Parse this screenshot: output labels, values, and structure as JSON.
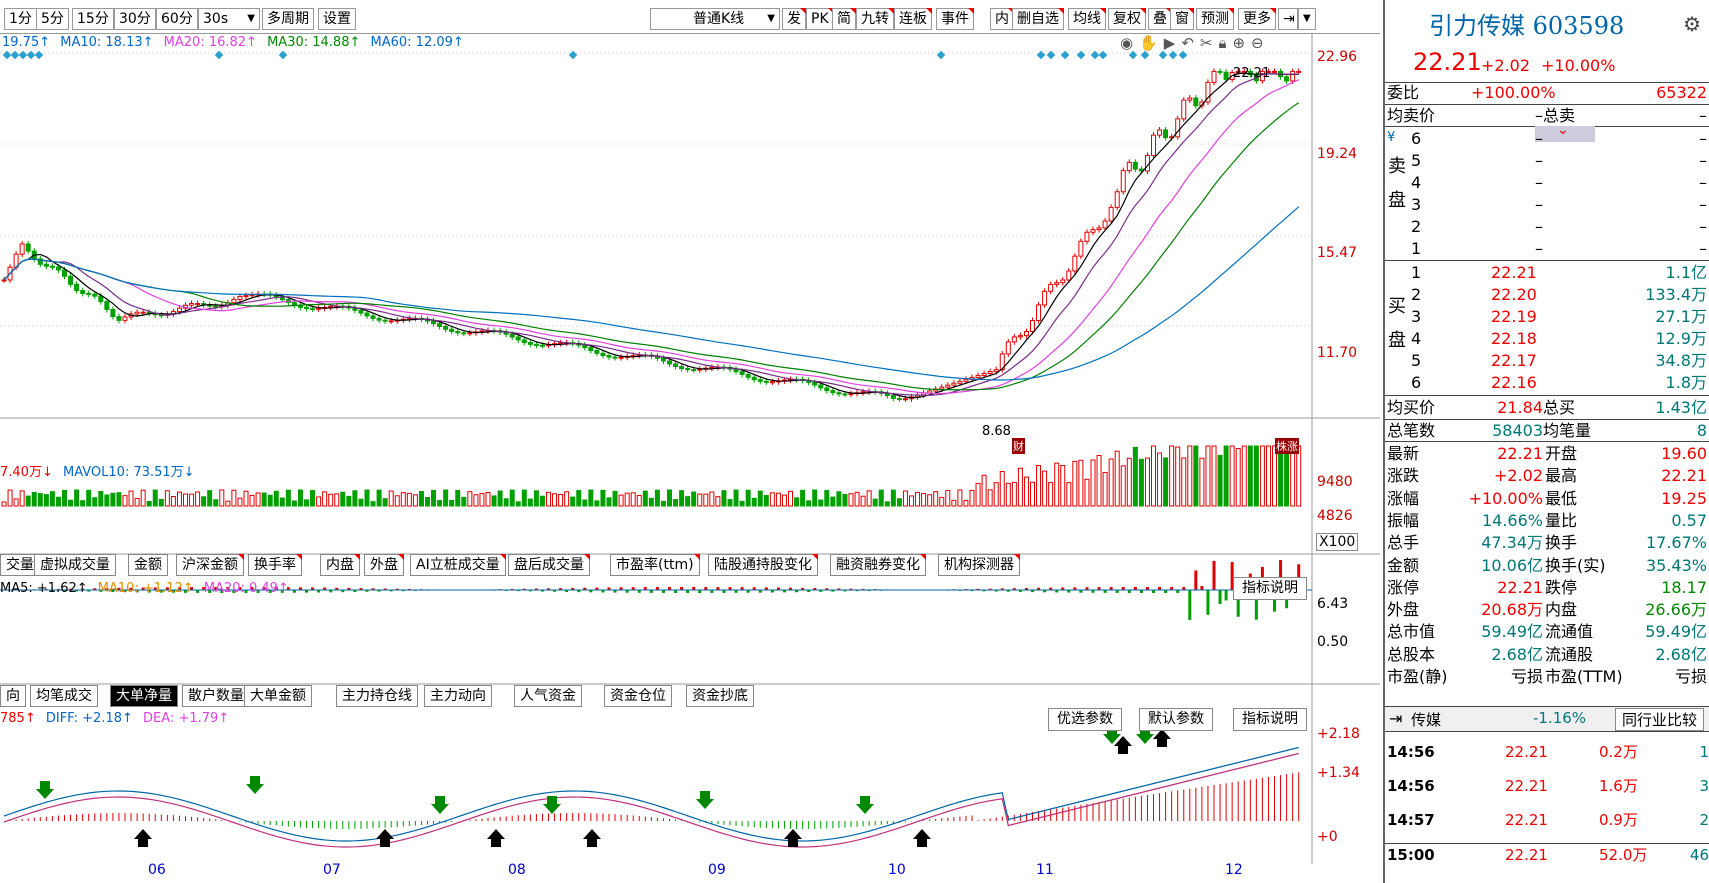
{
  "toolbar": {
    "periods": [
      "1分",
      "5分",
      "15分",
      "30分",
      "60分"
    ],
    "interval": "30s",
    "multi_period": "多周期",
    "settings": "设置",
    "kline_type": "普通K线",
    "tools": [
      "发",
      "PK",
      "简",
      "九转",
      "连板",
      "事件",
      "内",
      "删自选",
      "均线",
      "复权",
      "叠",
      "窗",
      "预测",
      "更多"
    ]
  },
  "ma_legend": {
    "ma5": "19.75↑",
    "ma10": "MA10: 18.13↑",
    "ma20": "MA20: 16.82↑",
    "ma30": "MA30: 14.88↑",
    "ma60": "MA60: 12.09↑"
  },
  "price_axis": [
    "22.96",
    "19.24",
    "15.47",
    "11.70"
  ],
  "price_marks": {
    "high": "22.21",
    "low": "8.68",
    "cai": "财",
    "zhang": "株涨"
  },
  "volume": {
    "legend_a": "7.40万↓",
    "legend_b": "MAVOL10: 73.51万↓",
    "axis": [
      "9480",
      "4826"
    ],
    "unit": "X100"
  },
  "indicator_tabs": [
    "交量",
    "虚拟成交量",
    "金额",
    "沪深金额",
    "换手率",
    "内盘",
    "外盘",
    "AI立桩成交量",
    "盘后成交量",
    "市盈率(ttm)",
    "陆股通持股变化",
    "融资融券变化",
    "机构探测器"
  ],
  "indicator_help": "指标说明",
  "net_panel": {
    "legend_a": "MA5: +1.62↑",
    "legend_b": "MA10: +1.12↑",
    "legend_c": "MA20: 0.49↑",
    "axis": [
      "6.43",
      "0.50"
    ]
  },
  "fund_tabs": [
    "向",
    "均笔成交",
    "大单净量",
    "散户数量",
    "大单金额",
    "主力持仓线",
    "主力动向",
    "人气资金",
    "资金仓位",
    "资金抄底"
  ],
  "macd_panel": {
    "legend_a": "785↑",
    "legend_b": "DIFF: +2.18↑",
    "legend_c": "DEA: +1.79↑",
    "buttons": [
      "优选参数",
      "默认参数",
      "指标说明"
    ],
    "axis": [
      "+2.18",
      "+1.34",
      "+0"
    ]
  },
  "x_axis": [
    "06",
    "07",
    "08",
    "09",
    "10",
    "11",
    "12"
  ],
  "quote": {
    "name": "引力传媒 603598",
    "price": "22.21",
    "change": "+2.02",
    "pct": "+10.00%",
    "weibi_label": "委比",
    "weibi_val": "+100.00%",
    "weicha_val": "65322",
    "avg_sell_label": "均卖价",
    "avg_sell_val": "–",
    "total_sell_label": "总卖",
    "total_sell_val": "–",
    "sell_label": "卖盘",
    "sell_levels": [
      "6",
      "5",
      "4",
      "3",
      "2",
      "1"
    ],
    "sell_dash": "–",
    "buy_label": "买盘",
    "buy_rows": [
      {
        "lvl": "1",
        "price": "22.21",
        "vol": "1.1亿"
      },
      {
        "lvl": "2",
        "price": "22.20",
        "vol": "133.4万"
      },
      {
        "lvl": "3",
        "price": "22.19",
        "vol": "27.1万"
      },
      {
        "lvl": "4",
        "price": "22.18",
        "vol": "12.9万"
      },
      {
        "lvl": "5",
        "price": "22.17",
        "vol": "34.8万"
      },
      {
        "lvl": "6",
        "price": "22.16",
        "vol": "1.8万"
      }
    ],
    "avg_buy_label": "均买价",
    "avg_buy_val": "21.84",
    "total_buy_label": "总买",
    "total_buy_val": "1.43亿",
    "total_trades_label": "总笔数",
    "total_trades_val": "58403",
    "avg_trade_label": "均笔量",
    "avg_trade_val": "8",
    "stats": [
      {
        "l1": "最新",
        "v1": "22.21",
        "c1": "red",
        "l2": "开盘",
        "v2": "19.60",
        "c2": "red"
      },
      {
        "l1": "涨跌",
        "v1": "+2.02",
        "c1": "red",
        "l2": "最高",
        "v2": "22.21",
        "c2": "red"
      },
      {
        "l1": "涨幅",
        "v1": "+10.00%",
        "c1": "red",
        "l2": "最低",
        "v2": "19.25",
        "c2": "red"
      },
      {
        "l1": "振幅",
        "v1": "14.66%",
        "c1": "teal",
        "l2": "量比",
        "v2": "0.57",
        "c2": "teal"
      },
      {
        "l1": "总手",
        "v1": "47.34万",
        "c1": "teal",
        "l2": "换手",
        "v2": "17.67%",
        "c2": "teal"
      },
      {
        "l1": "金额",
        "v1": "10.06亿",
        "c1": "teal",
        "l2": "换手(实)",
        "v2": "35.43%",
        "c2": "teal"
      },
      {
        "l1": "涨停",
        "v1": "22.21",
        "c1": "red",
        "l2": "跌停",
        "v2": "18.17",
        "c2": "grn"
      },
      {
        "l1": "外盘",
        "v1": "20.68万",
        "c1": "red",
        "l2": "内盘",
        "v2": "26.66万",
        "c2": "grn"
      },
      {
        "l1": "总市值",
        "v1": "59.49亿",
        "c1": "teal",
        "l2": "流通值",
        "v2": "59.49亿",
        "c2": "teal"
      },
      {
        "l1": "总股本",
        "v1": "2.68亿",
        "c1": "teal",
        "l2": "流通股",
        "v2": "2.68亿",
        "c2": "teal"
      },
      {
        "l1": "市盈(静)",
        "v1": "亏损",
        "c1": "blk",
        "l2": "市盈(TTM)",
        "v2": "亏损",
        "c2": "blk"
      }
    ],
    "sector_name": "传媒",
    "sector_pct": "-1.16%",
    "sector_btn": "同行业比较",
    "ticks": [
      {
        "time": "14:56",
        "price": "22.21",
        "vol": "0.2万",
        "n": "1"
      },
      {
        "time": "14:56",
        "price": "22.21",
        "vol": "1.6万",
        "n": "3"
      },
      {
        "time": "14:57",
        "price": "22.21",
        "vol": "0.9万",
        "n": "2"
      },
      {
        "time": "15:00",
        "price": "22.21",
        "vol": "52.0万",
        "n": "46"
      }
    ]
  },
  "colors": {
    "up": "#e00000",
    "down": "#00a000",
    "ma5": "#000000",
    "ma10": "#e09000",
    "ma20": "#e040e0",
    "ma30": "#008000",
    "ma60": "#0070c0"
  }
}
